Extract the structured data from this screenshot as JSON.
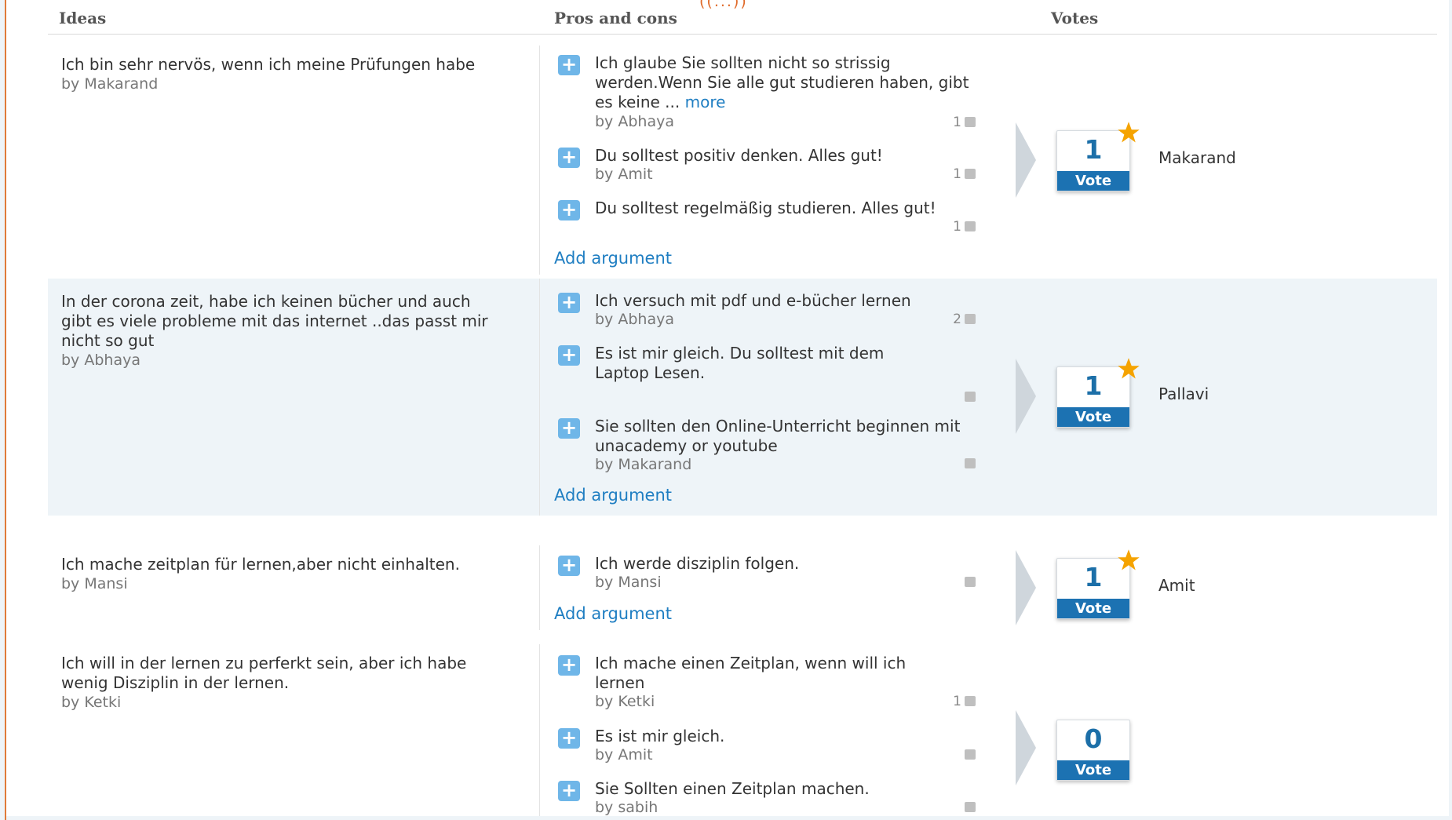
{
  "top_cut_text": "((...))",
  "header": {
    "ideas": "Ideas",
    "pros_cons": "Pros and cons",
    "votes": "Votes"
  },
  "rows": [
    {
      "idea_text": "Ich bin sehr nervös, wenn ich meine Prüfungen habe",
      "idea_by": "by Makarand",
      "arguments": [
        {
          "text": "Ich glaube Sie sollten nicht so strissig werden.Wenn Sie alle gut studieren haben, gibt es keine ...",
          "more": "more",
          "by": "by Abhaya",
          "likes": "1"
        },
        {
          "text": "Du solltest positiv denken. Alles gut!",
          "by": "by Amit",
          "likes": "1"
        },
        {
          "text": "Du solltest regelmäßig studieren. Alles gut!",
          "by": "",
          "likes": "1"
        }
      ],
      "add_argument": "Add argument",
      "vote_count": "1",
      "vote_label": "Vote",
      "voter": "Makarand"
    },
    {
      "idea_text": "In der corona zeit, habe ich keinen bücher und auch gibt es viele probleme mit das internet ..das passt mir nicht so gut",
      "idea_by": "by Abhaya",
      "arguments": [
        {
          "text": "Ich versuch mit pdf und e-bücher lernen",
          "by": "by Abhaya",
          "likes": "2"
        },
        {
          "text": "Es ist mir gleich. Du solltest mit dem Laptop Lesen.",
          "by": "",
          "likes": ""
        },
        {
          "text": "Sie sollten den Online-Unterricht beginnen mit unacademy or youtube",
          "by": "by Makarand",
          "likes": ""
        }
      ],
      "add_argument": "Add argument",
      "vote_count": "1",
      "vote_label": "Vote",
      "voter": "Pallavi"
    },
    {
      "idea_text": "Ich mache zeitplan für lernen,aber nicht einhalten.",
      "idea_by": "by Mansi",
      "arguments": [
        {
          "text": "Ich werde disziplin folgen.",
          "by": "by Mansi",
          "likes": ""
        }
      ],
      "add_argument": "Add argument",
      "vote_count": "1",
      "vote_label": "Vote",
      "voter": "Amit"
    },
    {
      "idea_text": "Ich will in der lernen zu perferkt sein, aber ich habe wenig Disziplin in der lernen.",
      "idea_by": "by Ketki",
      "arguments": [
        {
          "text": "Ich mache einen Zeitplan, wenn will ich lernen",
          "by": "by Ketki",
          "likes": "1"
        },
        {
          "text": "Es ist mir gleich.",
          "by": "by Amit",
          "likes": ""
        },
        {
          "text": "Sie Sollten einen Zeitplan machen.",
          "by": "by sabih",
          "likes": ""
        }
      ],
      "add_argument": "",
      "vote_count": "0",
      "vote_label": "Vote",
      "voter": ""
    }
  ],
  "colors": {
    "accent": "#1c72b2",
    "shaded_row": "#eef4f8",
    "star": "#f5a300",
    "frame": "#e07b39"
  },
  "icons": {
    "plus": "plus-icon",
    "thumb": "thumbs-up-icon",
    "star": "star-icon",
    "chevron": "chevron-right-icon"
  }
}
